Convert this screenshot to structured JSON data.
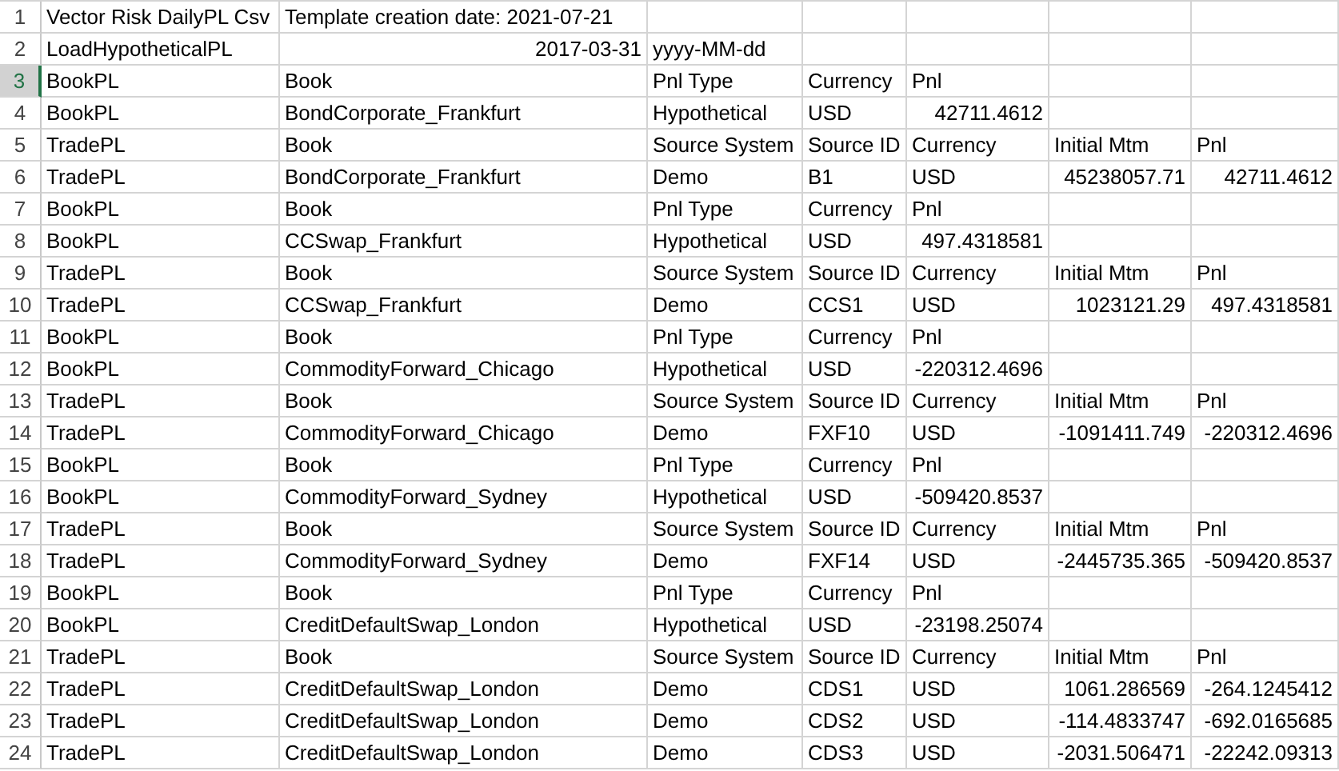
{
  "sheet": {
    "rows": [
      {
        "number": "1",
        "selected": false,
        "cells": {
          "a": {
            "text": "Vector Risk DailyPL Csv",
            "kind": "text"
          },
          "b": {
            "text": "Template creation date: 2021-07-21",
            "kind": "text"
          }
        }
      },
      {
        "number": "2",
        "selected": false,
        "cells": {
          "a": {
            "text": "LoadHypotheticalPL",
            "kind": "text"
          },
          "b": {
            "text": "2017-03-31",
            "kind": "number"
          },
          "c": {
            "text": "yyyy-MM-dd",
            "kind": "text"
          }
        }
      },
      {
        "number": "3",
        "selected": true,
        "cells": {
          "a": {
            "text": "BookPL",
            "kind": "text"
          },
          "b": {
            "text": "Book",
            "kind": "text"
          },
          "c": {
            "text": "Pnl Type",
            "kind": "text"
          },
          "d": {
            "text": "Currency",
            "kind": "text"
          },
          "e": {
            "text": "Pnl",
            "kind": "text"
          }
        }
      },
      {
        "number": "4",
        "selected": false,
        "cells": {
          "a": {
            "text": "BookPL",
            "kind": "text"
          },
          "b": {
            "text": "BondCorporate_Frankfurt",
            "kind": "text"
          },
          "c": {
            "text": "Hypothetical",
            "kind": "text"
          },
          "d": {
            "text": "USD",
            "kind": "text"
          },
          "e": {
            "text": "42711.4612",
            "kind": "number"
          }
        }
      },
      {
        "number": "5",
        "selected": false,
        "cells": {
          "a": {
            "text": "TradePL",
            "kind": "text"
          },
          "b": {
            "text": "Book",
            "kind": "text"
          },
          "c": {
            "text": "Source System",
            "kind": "text"
          },
          "d": {
            "text": "Source ID",
            "kind": "text"
          },
          "e": {
            "text": "Currency",
            "kind": "text"
          },
          "f": {
            "text": "Initial Mtm",
            "kind": "text"
          },
          "g": {
            "text": "Pnl",
            "kind": "text"
          }
        }
      },
      {
        "number": "6",
        "selected": false,
        "cells": {
          "a": {
            "text": "TradePL",
            "kind": "text"
          },
          "b": {
            "text": "BondCorporate_Frankfurt",
            "kind": "text"
          },
          "c": {
            "text": "Demo",
            "kind": "text"
          },
          "d": {
            "text": "B1",
            "kind": "text"
          },
          "e": {
            "text": "USD",
            "kind": "text"
          },
          "f": {
            "text": "45238057.71",
            "kind": "number"
          },
          "g": {
            "text": "42711.4612",
            "kind": "number"
          }
        }
      },
      {
        "number": "7",
        "selected": false,
        "cells": {
          "a": {
            "text": "BookPL",
            "kind": "text"
          },
          "b": {
            "text": "Book",
            "kind": "text"
          },
          "c": {
            "text": "Pnl Type",
            "kind": "text"
          },
          "d": {
            "text": "Currency",
            "kind": "text"
          },
          "e": {
            "text": "Pnl",
            "kind": "text"
          }
        }
      },
      {
        "number": "8",
        "selected": false,
        "cells": {
          "a": {
            "text": "BookPL",
            "kind": "text"
          },
          "b": {
            "text": "CCSwap_Frankfurt",
            "kind": "text"
          },
          "c": {
            "text": "Hypothetical",
            "kind": "text"
          },
          "d": {
            "text": "USD",
            "kind": "text"
          },
          "e": {
            "text": "497.4318581",
            "kind": "number"
          }
        }
      },
      {
        "number": "9",
        "selected": false,
        "cells": {
          "a": {
            "text": "TradePL",
            "kind": "text"
          },
          "b": {
            "text": "Book",
            "kind": "text"
          },
          "c": {
            "text": "Source System",
            "kind": "text"
          },
          "d": {
            "text": "Source ID",
            "kind": "text"
          },
          "e": {
            "text": "Currency",
            "kind": "text"
          },
          "f": {
            "text": "Initial Mtm",
            "kind": "text"
          },
          "g": {
            "text": "Pnl",
            "kind": "text"
          }
        }
      },
      {
        "number": "10",
        "selected": false,
        "cells": {
          "a": {
            "text": "TradePL",
            "kind": "text"
          },
          "b": {
            "text": "CCSwap_Frankfurt",
            "kind": "text"
          },
          "c": {
            "text": "Demo",
            "kind": "text"
          },
          "d": {
            "text": "CCS1",
            "kind": "text"
          },
          "e": {
            "text": "USD",
            "kind": "text"
          },
          "f": {
            "text": "1023121.29",
            "kind": "number"
          },
          "g": {
            "text": "497.4318581",
            "kind": "number"
          }
        }
      },
      {
        "number": "11",
        "selected": false,
        "cells": {
          "a": {
            "text": "BookPL",
            "kind": "text"
          },
          "b": {
            "text": "Book",
            "kind": "text"
          },
          "c": {
            "text": "Pnl Type",
            "kind": "text"
          },
          "d": {
            "text": "Currency",
            "kind": "text"
          },
          "e": {
            "text": "Pnl",
            "kind": "text"
          }
        }
      },
      {
        "number": "12",
        "selected": false,
        "cells": {
          "a": {
            "text": "BookPL",
            "kind": "text"
          },
          "b": {
            "text": "CommodityForward_Chicago",
            "kind": "text"
          },
          "c": {
            "text": "Hypothetical",
            "kind": "text"
          },
          "d": {
            "text": "USD",
            "kind": "text"
          },
          "e": {
            "text": "-220312.4696",
            "kind": "number"
          }
        }
      },
      {
        "number": "13",
        "selected": false,
        "cells": {
          "a": {
            "text": "TradePL",
            "kind": "text"
          },
          "b": {
            "text": "Book",
            "kind": "text"
          },
          "c": {
            "text": "Source System",
            "kind": "text"
          },
          "d": {
            "text": "Source ID",
            "kind": "text"
          },
          "e": {
            "text": "Currency",
            "kind": "text"
          },
          "f": {
            "text": "Initial Mtm",
            "kind": "text"
          },
          "g": {
            "text": "Pnl",
            "kind": "text"
          }
        }
      },
      {
        "number": "14",
        "selected": false,
        "cells": {
          "a": {
            "text": "TradePL",
            "kind": "text"
          },
          "b": {
            "text": "CommodityForward_Chicago",
            "kind": "text"
          },
          "c": {
            "text": "Demo",
            "kind": "text"
          },
          "d": {
            "text": "FXF10",
            "kind": "text"
          },
          "e": {
            "text": "USD",
            "kind": "text"
          },
          "f": {
            "text": "-1091411.749",
            "kind": "number"
          },
          "g": {
            "text": "-220312.4696",
            "kind": "number"
          }
        }
      },
      {
        "number": "15",
        "selected": false,
        "cells": {
          "a": {
            "text": "BookPL",
            "kind": "text"
          },
          "b": {
            "text": "Book",
            "kind": "text"
          },
          "c": {
            "text": "Pnl Type",
            "kind": "text"
          },
          "d": {
            "text": "Currency",
            "kind": "text"
          },
          "e": {
            "text": "Pnl",
            "kind": "text"
          }
        }
      },
      {
        "number": "16",
        "selected": false,
        "cells": {
          "a": {
            "text": "BookPL",
            "kind": "text"
          },
          "b": {
            "text": "CommodityForward_Sydney",
            "kind": "text"
          },
          "c": {
            "text": "Hypothetical",
            "kind": "text"
          },
          "d": {
            "text": "USD",
            "kind": "text"
          },
          "e": {
            "text": "-509420.8537",
            "kind": "number"
          }
        }
      },
      {
        "number": "17",
        "selected": false,
        "cells": {
          "a": {
            "text": "TradePL",
            "kind": "text"
          },
          "b": {
            "text": "Book",
            "kind": "text"
          },
          "c": {
            "text": "Source System",
            "kind": "text"
          },
          "d": {
            "text": "Source ID",
            "kind": "text"
          },
          "e": {
            "text": "Currency",
            "kind": "text"
          },
          "f": {
            "text": "Initial Mtm",
            "kind": "text"
          },
          "g": {
            "text": "Pnl",
            "kind": "text"
          }
        }
      },
      {
        "number": "18",
        "selected": false,
        "cells": {
          "a": {
            "text": "TradePL",
            "kind": "text"
          },
          "b": {
            "text": "CommodityForward_Sydney",
            "kind": "text"
          },
          "c": {
            "text": "Demo",
            "kind": "text"
          },
          "d": {
            "text": "FXF14",
            "kind": "text"
          },
          "e": {
            "text": "USD",
            "kind": "text"
          },
          "f": {
            "text": "-2445735.365",
            "kind": "number"
          },
          "g": {
            "text": "-509420.8537",
            "kind": "number"
          }
        }
      },
      {
        "number": "19",
        "selected": false,
        "cells": {
          "a": {
            "text": "BookPL",
            "kind": "text"
          },
          "b": {
            "text": "Book",
            "kind": "text"
          },
          "c": {
            "text": "Pnl Type",
            "kind": "text"
          },
          "d": {
            "text": "Currency",
            "kind": "text"
          },
          "e": {
            "text": "Pnl",
            "kind": "text"
          }
        }
      },
      {
        "number": "20",
        "selected": false,
        "cells": {
          "a": {
            "text": "BookPL",
            "kind": "text"
          },
          "b": {
            "text": "CreditDefaultSwap_London",
            "kind": "text"
          },
          "c": {
            "text": "Hypothetical",
            "kind": "text"
          },
          "d": {
            "text": "USD",
            "kind": "text"
          },
          "e": {
            "text": "-23198.25074",
            "kind": "number"
          }
        }
      },
      {
        "number": "21",
        "selected": false,
        "cells": {
          "a": {
            "text": "TradePL",
            "kind": "text"
          },
          "b": {
            "text": "Book",
            "kind": "text"
          },
          "c": {
            "text": "Source System",
            "kind": "text"
          },
          "d": {
            "text": "Source ID",
            "kind": "text"
          },
          "e": {
            "text": "Currency",
            "kind": "text"
          },
          "f": {
            "text": "Initial Mtm",
            "kind": "text"
          },
          "g": {
            "text": "Pnl",
            "kind": "text"
          }
        }
      },
      {
        "number": "22",
        "selected": false,
        "cells": {
          "a": {
            "text": "TradePL",
            "kind": "text"
          },
          "b": {
            "text": "CreditDefaultSwap_London",
            "kind": "text"
          },
          "c": {
            "text": "Demo",
            "kind": "text"
          },
          "d": {
            "text": "CDS1",
            "kind": "text"
          },
          "e": {
            "text": "USD",
            "kind": "text"
          },
          "f": {
            "text": "1061.286569",
            "kind": "number"
          },
          "g": {
            "text": "-264.1245412",
            "kind": "number"
          }
        }
      },
      {
        "number": "23",
        "selected": false,
        "cells": {
          "a": {
            "text": "TradePL",
            "kind": "text"
          },
          "b": {
            "text": "CreditDefaultSwap_London",
            "kind": "text"
          },
          "c": {
            "text": "Demo",
            "kind": "text"
          },
          "d": {
            "text": "CDS2",
            "kind": "text"
          },
          "e": {
            "text": "USD",
            "kind": "text"
          },
          "f": {
            "text": "-114.4833747",
            "kind": "number"
          },
          "g": {
            "text": "-692.0165685",
            "kind": "number"
          }
        }
      },
      {
        "number": "24",
        "selected": false,
        "cells": {
          "a": {
            "text": "TradePL",
            "kind": "text"
          },
          "b": {
            "text": "CreditDefaultSwap_London",
            "kind": "text"
          },
          "c": {
            "text": "Demo",
            "kind": "text"
          },
          "d": {
            "text": "CDS3",
            "kind": "text"
          },
          "e": {
            "text": "USD",
            "kind": "text"
          },
          "f": {
            "text": "-2031.506471",
            "kind": "number"
          },
          "g": {
            "text": "-22242.09313",
            "kind": "number"
          }
        }
      }
    ]
  }
}
